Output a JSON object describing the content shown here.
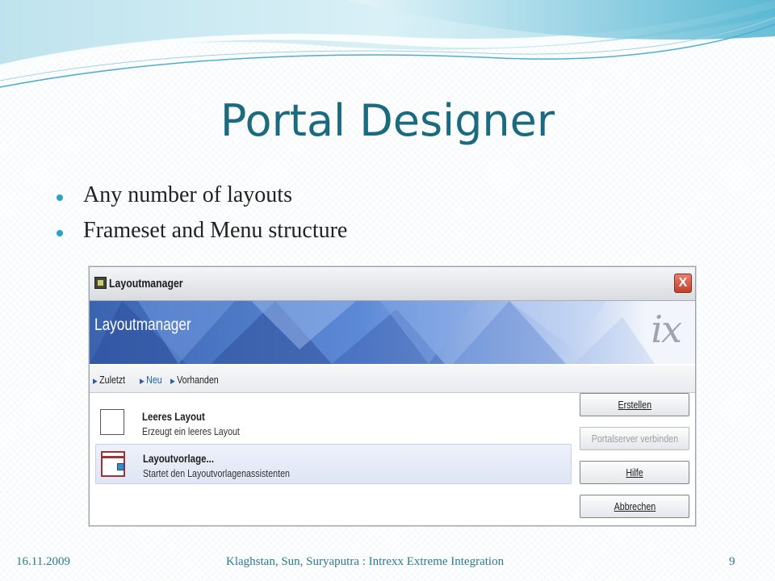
{
  "slide": {
    "title": "Portal Designer",
    "bullets": [
      "Any number of layouts",
      "Frameset and Menu structure"
    ],
    "footer": {
      "date": "16.11.2009",
      "center": "Klaghstan, Sun, Suryaputra : Intrexx Extreme Integration",
      "page": "9"
    },
    "colors": {
      "title": "#1a6a80",
      "bullet": "#2aa3c6",
      "footer": "#2a7a90"
    }
  },
  "window": {
    "title": "Layoutmanager",
    "close_label": "X",
    "banner_title": "Layoutmanager",
    "banner_logo": "ix",
    "tabs": [
      {
        "label": "Zuletzt",
        "active": false
      },
      {
        "label": "Neu",
        "active": true
      },
      {
        "label": "Vorhanden",
        "active": false
      }
    ],
    "items": [
      {
        "title": "Leeres Layout",
        "description": "Erzeugt ein leeres Layout",
        "icon": "blank-layout-icon"
      },
      {
        "title": "Layoutvorlage...",
        "description": "Startet den Layoutvorlagenassistenten",
        "icon": "layout-template-icon"
      }
    ],
    "buttons": [
      {
        "label": "Erstellen",
        "enabled": true
      },
      {
        "label": "Portalserver verbinden",
        "enabled": false
      },
      {
        "label": "Hilfe",
        "enabled": true
      },
      {
        "label": "Abbrechen",
        "enabled": true
      }
    ]
  }
}
